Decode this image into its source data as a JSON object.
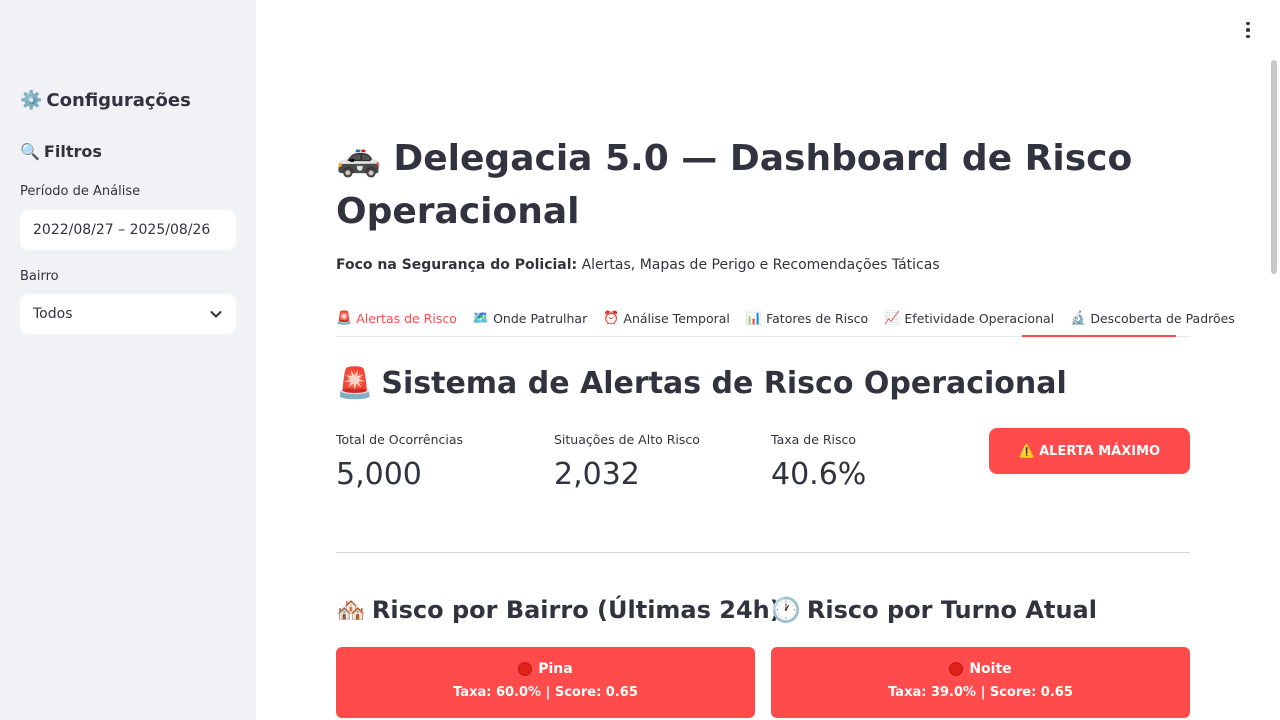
{
  "sidebar": {
    "title_icon": "⚙️",
    "title": "Configurações",
    "filters_icon": "🔍",
    "filters_title": "Filtros",
    "period_label": "Período de Análise",
    "period_value": "2022/08/27 – 2025/08/26",
    "neighborhood_label": "Bairro",
    "neighborhood_value": "Todos"
  },
  "header": {
    "title_icon": "🚓",
    "title": "Delegacia 5.0 — Dashboard de Risco Operacional",
    "subtitle_bold": "Foco na Segurança do Policial:",
    "subtitle_rest": " Alertas, Mapas de Perigo e Recomendações Táticas"
  },
  "tabs": [
    {
      "icon": "🚨",
      "label": "Alertas de Risco"
    },
    {
      "icon": "🗺️",
      "label": "Onde Patrulhar"
    },
    {
      "icon": "⏰",
      "label": "Análise Temporal"
    },
    {
      "icon": "📊",
      "label": "Fatores de Risco"
    },
    {
      "icon": "📈",
      "label": "Efetividade Operacional"
    },
    {
      "icon": "🔬",
      "label": "Descoberta de Padrões"
    }
  ],
  "section": {
    "icon": "🚨",
    "title": "Sistema de Alertas de Risco Operacional"
  },
  "metrics": [
    {
      "label": "Total de Ocorrências",
      "value": "5,000"
    },
    {
      "label": "Situações de Alto Risco",
      "value": "2,032"
    },
    {
      "label": "Taxa de Risco",
      "value": "40.6%"
    }
  ],
  "alert_button": {
    "icon": "⚠️",
    "label": "ALERTA MÁXIMO"
  },
  "columns": [
    {
      "icon": "🏘️",
      "title": "Risco por Bairro (Últimas 24h)",
      "card": {
        "name": "Pina",
        "stats": "Taxa: 60.0% | Score: 0.65"
      }
    },
    {
      "icon": "🕐",
      "title": "Risco por Turno Atual",
      "card": {
        "name": "Noite",
        "stats": "Taxa: 39.0% | Score: 0.65"
      }
    }
  ],
  "colors": {
    "accent": "#ff4b4b",
    "sidebar_bg": "#f0f2f6",
    "text": "#31333f"
  }
}
